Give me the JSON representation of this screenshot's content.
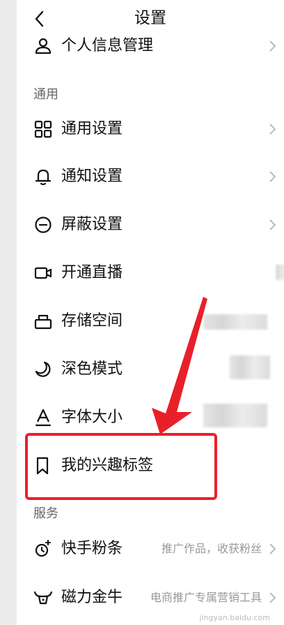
{
  "header": {
    "title": "设置"
  },
  "top_item": {
    "label": "个人信息管理"
  },
  "sections": {
    "general": "通用",
    "service": "服务"
  },
  "items": {
    "general_settings": "通用设置",
    "notification_settings": "通知设置",
    "block_settings": "屏蔽设置",
    "open_live": "开通直播",
    "storage": "存储空间",
    "dark_mode": "深色模式",
    "font_size": "字体大小",
    "interest_tags": "我的兴趣标签",
    "kuaishou_fenti": "快手粉条",
    "kuaishou_fenti_sub": "推广作品，收获粉丝",
    "cili_jinniu": "磁力金牛",
    "cili_jinniu_sub": "电商推广专属营销工具"
  },
  "watermark": "jingyan.baidu.com",
  "colors": {
    "highlight": "#e8202a",
    "text": "#111111",
    "secondary": "#999999"
  }
}
